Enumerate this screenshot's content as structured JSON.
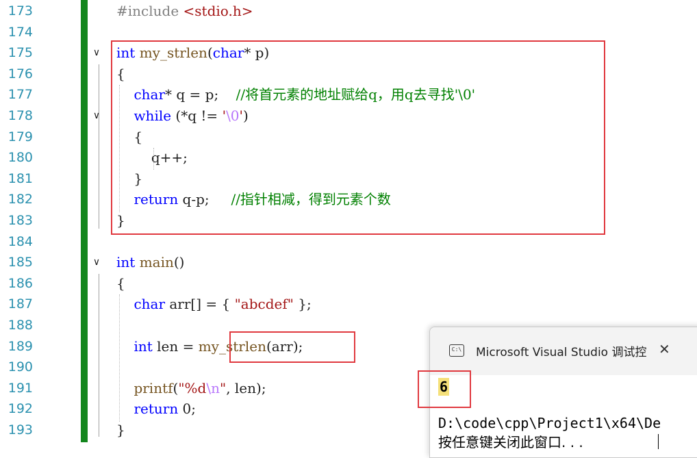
{
  "editor": {
    "lines": [
      {
        "n": "173",
        "code": [
          {
            "c": "pp",
            "t": "#include "
          },
          {
            "c": "str",
            "t": "<stdio.h>"
          }
        ]
      },
      {
        "n": "174",
        "code": []
      },
      {
        "n": "175",
        "code": [
          {
            "c": "kw",
            "t": "int"
          },
          {
            "c": "plain",
            "t": " "
          },
          {
            "c": "fn",
            "t": "my_strlen"
          },
          {
            "c": "plain",
            "t": "("
          },
          {
            "c": "kw",
            "t": "char"
          },
          {
            "c": "plain",
            "t": "* p)"
          }
        ]
      },
      {
        "n": "176",
        "code": [
          {
            "c": "plain",
            "t": "{"
          }
        ]
      },
      {
        "n": "177",
        "code": [
          {
            "c": "plain",
            "t": "    "
          },
          {
            "c": "kw",
            "t": "char"
          },
          {
            "c": "plain",
            "t": "* q = p;    "
          },
          {
            "c": "cmt",
            "t": "//将首元素的地址赋给q，用q去寻找'\\0'"
          }
        ]
      },
      {
        "n": "178",
        "code": [
          {
            "c": "plain",
            "t": "    "
          },
          {
            "c": "kw",
            "t": "while"
          },
          {
            "c": "plain",
            "t": " (*q != "
          },
          {
            "c": "str",
            "t": "'"
          },
          {
            "c": "esc",
            "t": "\\0"
          },
          {
            "c": "str",
            "t": "'"
          },
          {
            "c": "plain",
            "t": ")"
          }
        ]
      },
      {
        "n": "179",
        "code": [
          {
            "c": "plain",
            "t": "    {"
          }
        ]
      },
      {
        "n": "180",
        "code": [
          {
            "c": "plain",
            "t": "        q++;"
          }
        ]
      },
      {
        "n": "181",
        "code": [
          {
            "c": "plain",
            "t": "    }"
          }
        ]
      },
      {
        "n": "182",
        "code": [
          {
            "c": "plain",
            "t": "    "
          },
          {
            "c": "kw",
            "t": "return"
          },
          {
            "c": "plain",
            "t": " q-p;     "
          },
          {
            "c": "cmt",
            "t": "//指针相减，得到元素个数"
          }
        ]
      },
      {
        "n": "183",
        "code": [
          {
            "c": "plain",
            "t": "}"
          }
        ]
      },
      {
        "n": "184",
        "code": []
      },
      {
        "n": "185",
        "code": [
          {
            "c": "kw",
            "t": "int"
          },
          {
            "c": "plain",
            "t": " "
          },
          {
            "c": "fn",
            "t": "main"
          },
          {
            "c": "plain",
            "t": "()"
          }
        ]
      },
      {
        "n": "186",
        "code": [
          {
            "c": "plain",
            "t": "{"
          }
        ]
      },
      {
        "n": "187",
        "code": [
          {
            "c": "plain",
            "t": "    "
          },
          {
            "c": "kw",
            "t": "char"
          },
          {
            "c": "plain",
            "t": " arr[] = { "
          },
          {
            "c": "str",
            "t": "\"abcdef\""
          },
          {
            "c": "plain",
            "t": " };"
          }
        ]
      },
      {
        "n": "188",
        "code": []
      },
      {
        "n": "189",
        "code": [
          {
            "c": "plain",
            "t": "    "
          },
          {
            "c": "kw",
            "t": "int"
          },
          {
            "c": "plain",
            "t": " len = "
          },
          {
            "c": "fn",
            "t": "my_strlen"
          },
          {
            "c": "plain",
            "t": "(arr);"
          }
        ]
      },
      {
        "n": "190",
        "code": []
      },
      {
        "n": "191",
        "code": [
          {
            "c": "plain",
            "t": "    "
          },
          {
            "c": "fn",
            "t": "printf"
          },
          {
            "c": "plain",
            "t": "("
          },
          {
            "c": "str",
            "t": "\"%d"
          },
          {
            "c": "esc",
            "t": "\\n"
          },
          {
            "c": "str",
            "t": "\""
          },
          {
            "c": "plain",
            "t": ", len);"
          }
        ]
      },
      {
        "n": "192",
        "code": [
          {
            "c": "plain",
            "t": "    "
          },
          {
            "c": "kw",
            "t": "return"
          },
          {
            "c": "plain",
            "t": " 0;"
          }
        ]
      },
      {
        "n": "193",
        "code": [
          {
            "c": "plain",
            "t": "}"
          }
        ]
      }
    ],
    "folds": [
      "175",
      "178",
      "185"
    ],
    "fold_glyph": "∨"
  },
  "console": {
    "icon_label": "C:\\",
    "title": "Microsoft Visual Studio 调试控",
    "close_glyph": "✕",
    "output_value": "6",
    "path_line": "D:\\code\\cpp\\Project1\\x64\\De",
    "hint_line": "按任意键关闭此窗口. . ."
  },
  "colors": {
    "keyword": "#0000ff",
    "function": "#74531f",
    "string": "#a31515",
    "comment": "#008000",
    "line_number": "#2b91af",
    "change_bar": "#13861d",
    "highlight_box": "#e0383e"
  }
}
